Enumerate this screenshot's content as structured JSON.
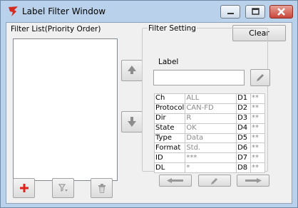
{
  "window": {
    "title": "Label Filter Window"
  },
  "buttons": {
    "clear": "Clear"
  },
  "filter_list": {
    "label": "Filter List(Priority Order)"
  },
  "filter_setting": {
    "group_label": "Filter Setting",
    "label_field_label": "Label",
    "label_value": "",
    "rows": [
      {
        "key": "Ch",
        "value": "ALL",
        "d": "D1",
        "s": "**"
      },
      {
        "key": "Protocol",
        "value": "CAN-FD",
        "d": "D2",
        "s": "**"
      },
      {
        "key": "Dir",
        "value": "R",
        "d": "D3",
        "s": "**"
      },
      {
        "key": "State",
        "value": "OK",
        "d": "D4",
        "s": "**"
      },
      {
        "key": "Type",
        "value": "Data",
        "d": "D5",
        "s": "**"
      },
      {
        "key": "Format",
        "value": "Std.",
        "d": "D6",
        "s": "**"
      },
      {
        "key": "ID",
        "value": "***",
        "d": "D7",
        "s": "**"
      },
      {
        "key": "DL",
        "value": "*",
        "d": "D8",
        "s": "**"
      }
    ]
  },
  "colors": {
    "accent_red": "#e0231c",
    "title_bar": "#b9d1ea"
  }
}
